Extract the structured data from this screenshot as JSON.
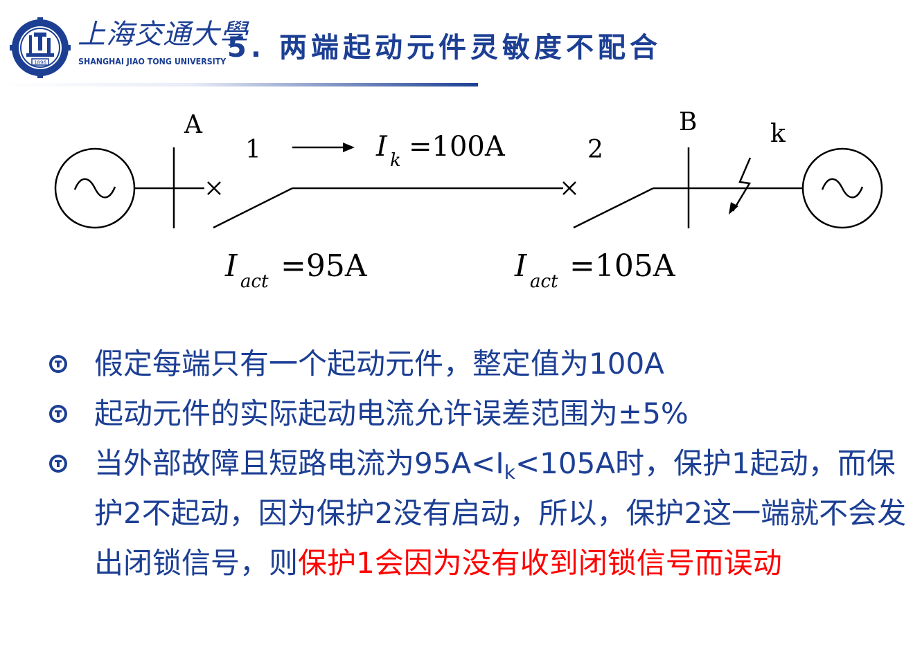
{
  "header": {
    "logo_cn": "上海交通大學",
    "logo_en": "SHANGHAI JIAO TONG UNIVERSITY",
    "logo_year": "1896",
    "title": "5. 两端起动元件灵敏度不配合"
  },
  "diagram": {
    "bus_a": "A",
    "bus_b": "B",
    "relay_1": "1",
    "relay_2": "2",
    "fault_label": "k",
    "current_symbol": "I",
    "current_sub": "k",
    "current_value": "=100A",
    "act_symbol": "I",
    "act_sub": "act",
    "act_1_value": "=95A",
    "act_2_value": "=105A"
  },
  "bullets": [
    {
      "text": "假定每端只有一个起动元件，整定值为100A"
    },
    {
      "text": "起动元件的实际起动电流允许误差范围为±5%"
    },
    {
      "p1": "当外部故障且短路电流为95A<I",
      "sub": "k",
      "p2": "<105A时，保护1起动，而保护2不起动，因为保护2没有启动，所以，保护2这一端就不会发出闭锁信号，则",
      "red": "保护1会因为没有收到闭锁信号而误动"
    }
  ],
  "colors": {
    "primary": "#1c3f94",
    "highlight": "#ff0000"
  }
}
